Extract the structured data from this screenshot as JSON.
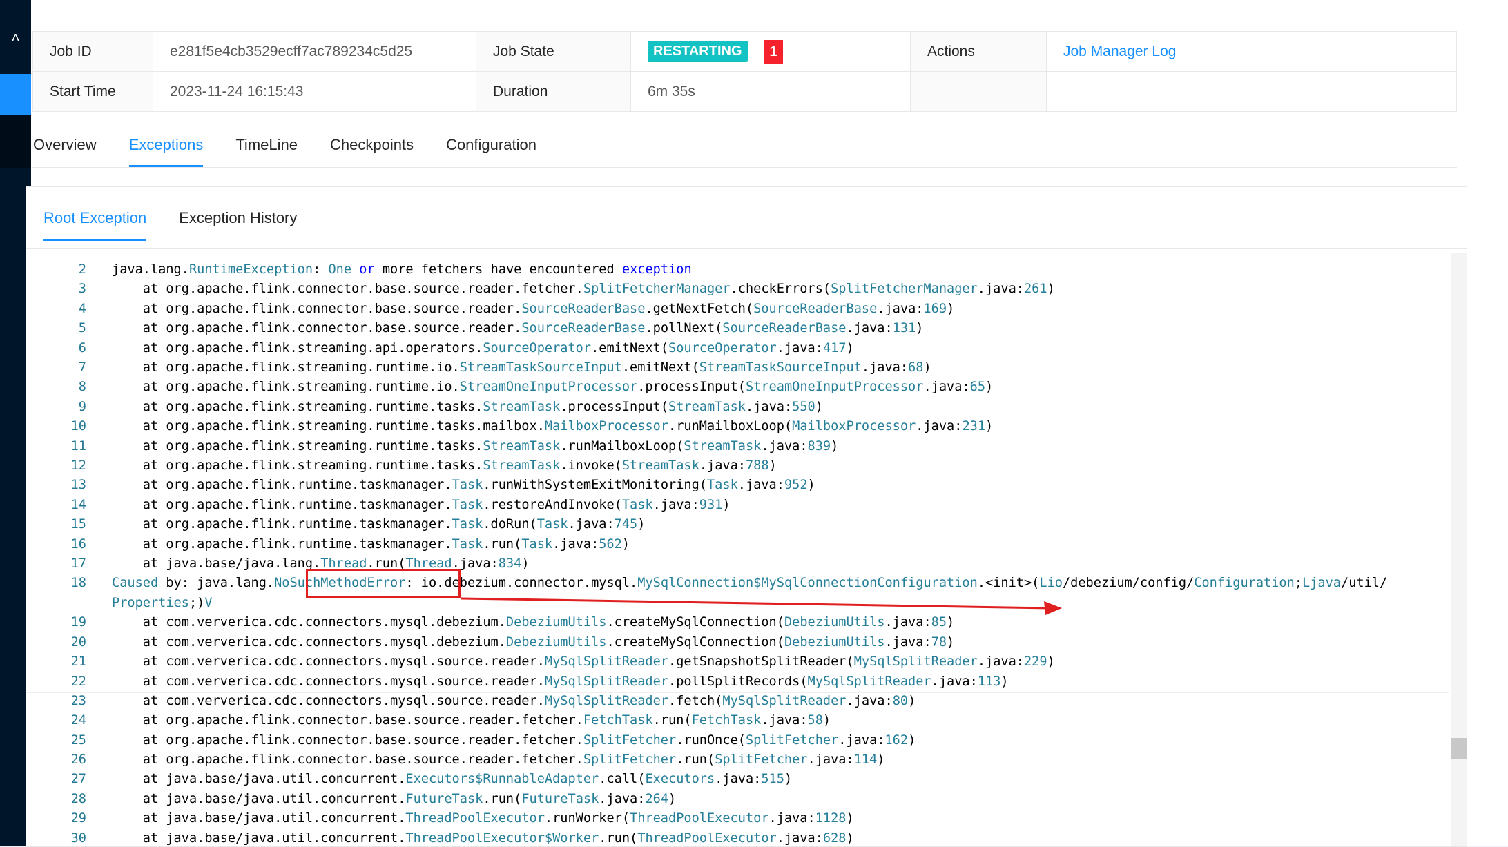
{
  "sidebar": {
    "collapse_icon": "chevron-up-icon"
  },
  "job": {
    "id_label": "Job ID",
    "id_value": "e281f5e4cb3529ecff7ac789234c5d25",
    "state_label": "Job State",
    "state_value": "RESTARTING",
    "state_count": "1",
    "actions_label": "Actions",
    "actions_link": "Job Manager Log",
    "start_label": "Start Time",
    "start_value": "2023-11-24 16:15:43",
    "duration_label": "Duration",
    "duration_value": "6m 35s"
  },
  "tabs": [
    "Overview",
    "Exceptions",
    "TimeLine",
    "Checkpoints",
    "Configuration"
  ],
  "subtabs": [
    "Root Exception",
    "Exception History"
  ],
  "code_lines": [
    {
      "n": "2",
      "t": "java.lang.RuntimeException: One or more fetchers have encountered exception"
    },
    {
      "n": "3",
      "t": "    at org.apache.flink.connector.base.source.reader.fetcher.SplitFetcherManager.checkErrors(SplitFetcherManager.java:261)"
    },
    {
      "n": "4",
      "t": "    at org.apache.flink.connector.base.source.reader.SourceReaderBase.getNextFetch(SourceReaderBase.java:169)"
    },
    {
      "n": "5",
      "t": "    at org.apache.flink.connector.base.source.reader.SourceReaderBase.pollNext(SourceReaderBase.java:131)"
    },
    {
      "n": "6",
      "t": "    at org.apache.flink.streaming.api.operators.SourceOperator.emitNext(SourceOperator.java:417)"
    },
    {
      "n": "7",
      "t": "    at org.apache.flink.streaming.runtime.io.StreamTaskSourceInput.emitNext(StreamTaskSourceInput.java:68)"
    },
    {
      "n": "8",
      "t": "    at org.apache.flink.streaming.runtime.io.StreamOneInputProcessor.processInput(StreamOneInputProcessor.java:65)"
    },
    {
      "n": "9",
      "t": "    at org.apache.flink.streaming.runtime.tasks.StreamTask.processInput(StreamTask.java:550)"
    },
    {
      "n": "10",
      "t": "    at org.apache.flink.streaming.runtime.tasks.mailbox.MailboxProcessor.runMailboxLoop(MailboxProcessor.java:231)"
    },
    {
      "n": "11",
      "t": "    at org.apache.flink.streaming.runtime.tasks.StreamTask.runMailboxLoop(StreamTask.java:839)"
    },
    {
      "n": "12",
      "t": "    at org.apache.flink.streaming.runtime.tasks.StreamTask.invoke(StreamTask.java:788)"
    },
    {
      "n": "13",
      "t": "    at org.apache.flink.runtime.taskmanager.Task.runWithSystemExitMonitoring(Task.java:952)"
    },
    {
      "n": "14",
      "t": "    at org.apache.flink.runtime.taskmanager.Task.restoreAndInvoke(Task.java:931)"
    },
    {
      "n": "15",
      "t": "    at org.apache.flink.runtime.taskmanager.Task.doRun(Task.java:745)"
    },
    {
      "n": "16",
      "t": "    at org.apache.flink.runtime.taskmanager.Task.run(Task.java:562)"
    },
    {
      "n": "17",
      "t": "    at java.base/java.lang.Thread.run(Thread.java:834)"
    },
    {
      "n": "18",
      "t": "Caused by: java.lang.NoSuchMethodError: io.debezium.connector.mysql.MySqlConnection$MySqlConnectionConfiguration.<init>(Lio/debezium/config/Configuration;Ljava/util/"
    },
    {
      "n": "",
      "t": "Properties;)V"
    },
    {
      "n": "19",
      "t": "    at com.ververica.cdc.connectors.mysql.debezium.DebeziumUtils.createMySqlConnection(DebeziumUtils.java:85)"
    },
    {
      "n": "20",
      "t": "    at com.ververica.cdc.connectors.mysql.debezium.DebeziumUtils.createMySqlConnection(DebeziumUtils.java:78)"
    },
    {
      "n": "21",
      "t": "    at com.ververica.cdc.connectors.mysql.source.reader.MySqlSplitReader.getSnapshotSplitReader(MySqlSplitReader.java:229)"
    },
    {
      "n": "22",
      "t": "    at com.ververica.cdc.connectors.mysql.source.reader.MySqlSplitReader.pollSplitRecords(MySqlSplitReader.java:113)"
    },
    {
      "n": "23",
      "t": "    at com.ververica.cdc.connectors.mysql.source.reader.MySqlSplitReader.fetch(MySqlSplitReader.java:80)"
    },
    {
      "n": "24",
      "t": "    at org.apache.flink.connector.base.source.reader.fetcher.FetchTask.run(FetchTask.java:58)"
    },
    {
      "n": "25",
      "t": "    at org.apache.flink.connector.base.source.reader.fetcher.SplitFetcher.runOnce(SplitFetcher.java:162)"
    },
    {
      "n": "26",
      "t": "    at org.apache.flink.connector.base.source.reader.fetcher.SplitFetcher.run(SplitFetcher.java:114)"
    },
    {
      "n": "27",
      "t": "    at java.base/java.util.concurrent.Executors$RunnableAdapter.call(Executors.java:515)"
    },
    {
      "n": "28",
      "t": "    at java.base/java.util.concurrent.FutureTask.run(FutureTask.java:264)"
    },
    {
      "n": "29",
      "t": "    at java.base/java.util.concurrent.ThreadPoolExecutor.runWorker(ThreadPoolExecutor.java:1128)"
    },
    {
      "n": "30",
      "t": "    at java.base/java.util.concurrent.ThreadPoolExecutor$Worker.run(ThreadPoolExecutor.java:628)"
    }
  ],
  "colors": {
    "primary": "#1890ff",
    "restarting": "#13c2c2",
    "alert": "#f5222d",
    "annotation": "#e02020",
    "type_name": "#267f99",
    "keyword": "#0000ff"
  }
}
